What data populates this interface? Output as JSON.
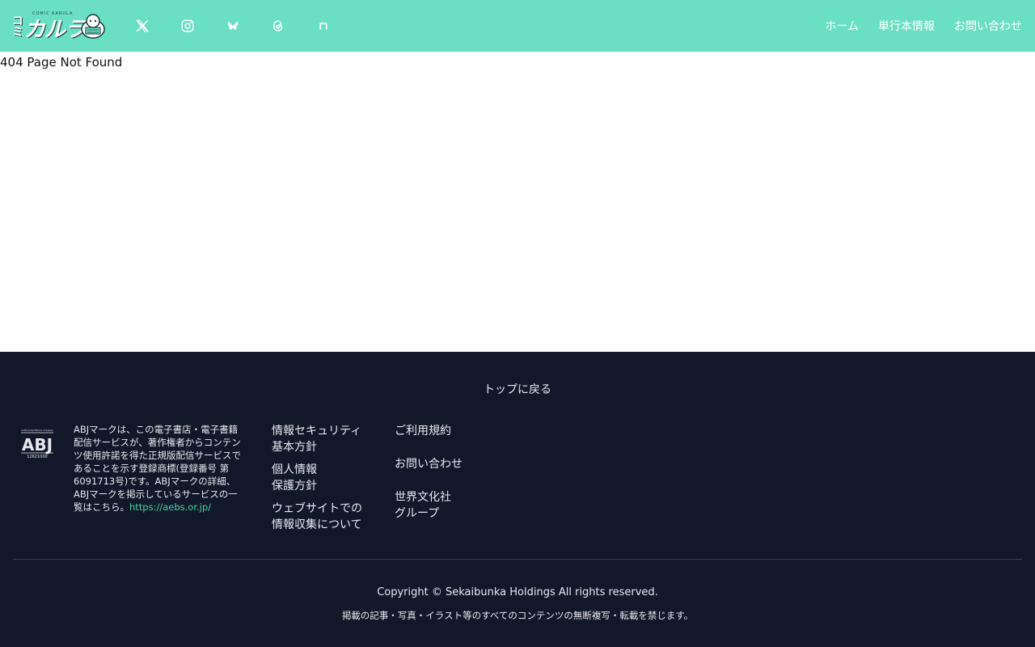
{
  "header": {
    "logo_main": "カルラ",
    "logo_side": "コミ",
    "logo_top": "COMIC KARULA",
    "nav": {
      "home": "ホーム",
      "books": "単行本情報",
      "contact": "お問い合わせ"
    },
    "social_icons": [
      "x-icon",
      "instagram-icon",
      "bluesky-icon",
      "threads-icon",
      "note-icon"
    ]
  },
  "main": {
    "message": "404 Page Not Found"
  },
  "footer": {
    "back_to_top": "トップに戻る",
    "abj": {
      "description": "ABJマークは、この電子書店・電子書籍配信サービスが、著作権者からコンテンツ使用許諾を得た正規版配信サービスであることを示す登録商標(登録番号 第6091713号)です。ABJマークの詳細、ABJマークを掲示しているサービスの一覧はこちら。",
      "link": "https://aebs.or.jp/",
      "mark_label": "ABJ",
      "mark_number": "12621000",
      "mark_caption": "Authorized Books of Japan"
    },
    "col1": {
      "security_line1": "情報セキュリティ",
      "security_line2": "基本方針",
      "privacy_line1": "個人情報",
      "privacy_line2": "保護方針",
      "web_line1": "ウェブサイトでの",
      "web_line2": "情報収集について"
    },
    "col2": {
      "terms": "ご利用規約",
      "contact": "お問い合わせ",
      "group_line1": "世界文化社",
      "group_line2": "グループ"
    },
    "copyright": "Copyright © Sekaibunka Holdings All rights reserved.",
    "notice": "掲載の記事・写真・イラスト等のすべてのコンテンツの無断複写・転載を禁じます。"
  },
  "colors": {
    "header_bg": "#6adfc4",
    "footer_bg": "#121828",
    "link_accent": "#3fd3b1"
  }
}
